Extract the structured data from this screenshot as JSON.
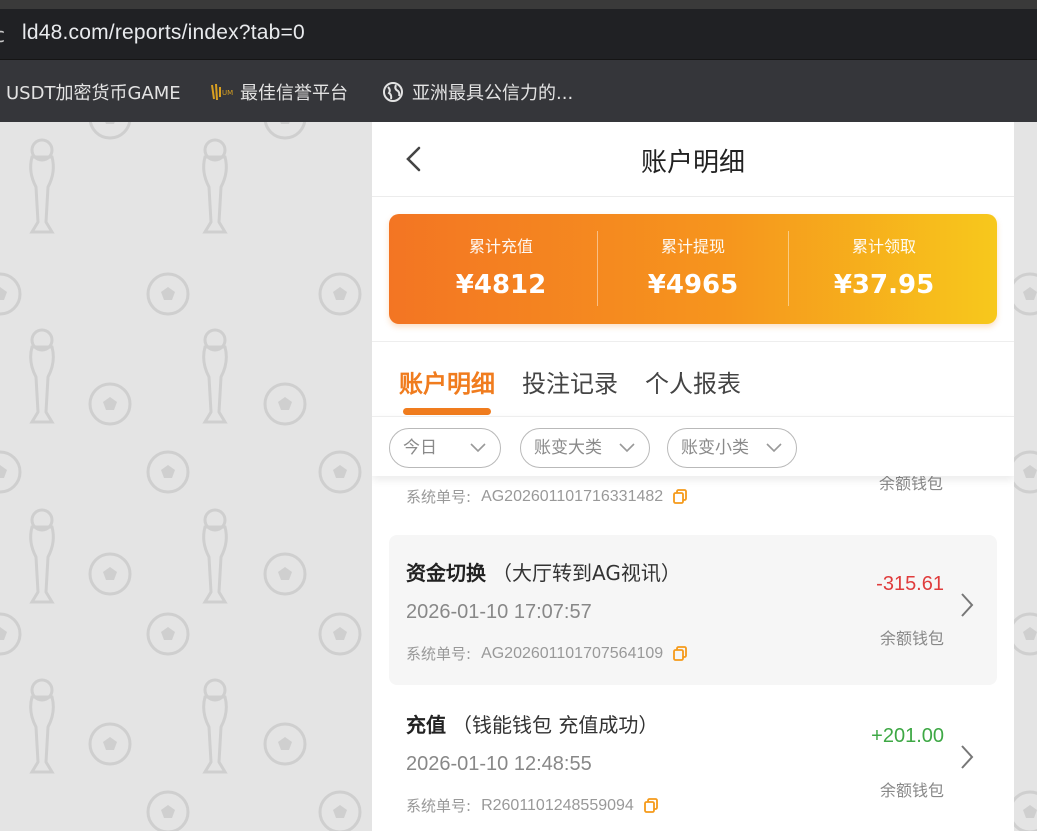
{
  "browser": {
    "url": "ld48.com/reports/index?tab=0",
    "bookmarks": [
      {
        "label": "USDT加密货币GAME",
        "icon": "none"
      },
      {
        "label": "最佳信誉平台",
        "icon": "site-logo-icon"
      },
      {
        "label": "亚洲最具公信力的...",
        "icon": "globe-icon"
      }
    ]
  },
  "header": {
    "title": "账户明细"
  },
  "summary": [
    {
      "label": "累计充值",
      "value": "¥4812"
    },
    {
      "label": "累计提现",
      "value": "¥4965"
    },
    {
      "label": "累计领取",
      "value": "¥37.95"
    }
  ],
  "tabs": [
    {
      "label": "账户明细",
      "active": true
    },
    {
      "label": "投注记录",
      "active": false
    },
    {
      "label": "个人报表",
      "active": false
    }
  ],
  "filters": [
    {
      "label": "今日"
    },
    {
      "label": "账变大类"
    },
    {
      "label": "账变小类"
    }
  ],
  "records": [
    {
      "order_label": "系统单号:",
      "order_no": "AG202601101716331482",
      "wallet": "余额钱包"
    },
    {
      "title": "资金切换",
      "subtitle": "（大厅转到AG视讯）",
      "time": "2026-01-10 17:07:57",
      "order_label": "系统单号:",
      "order_no": "AG202601101707564109",
      "amount": "-315.61",
      "wallet": "余额钱包"
    },
    {
      "title": "充值",
      "subtitle": "（钱能钱包 充值成功）",
      "time": "2026-01-10 12:48:55",
      "order_label": "系统单号:",
      "order_no": "R2601101248559094",
      "amount": "+201.00",
      "wallet": "余额钱包"
    }
  ],
  "colors": {
    "accent": "#f07c1e",
    "negative": "#e03c3c",
    "positive": "#3ea845"
  }
}
